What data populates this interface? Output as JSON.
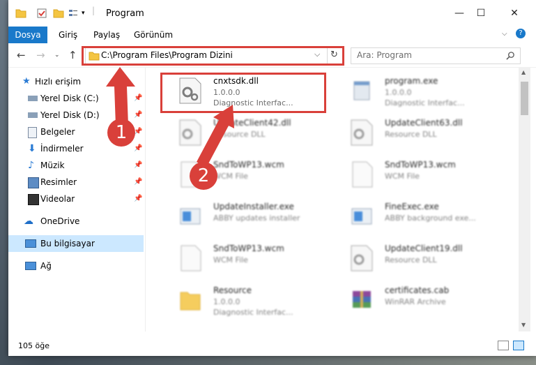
{
  "window": {
    "title": "Program"
  },
  "ribbon": {
    "file_tab": "Dosya",
    "tabs": [
      "Giriş",
      "Paylaş",
      "Görünüm"
    ]
  },
  "nav": {
    "address": "C:\\Program Files\\Program Dizini",
    "search_placeholder": "Ara: Program"
  },
  "sidebar": {
    "quick_access": "Hızlı erişim",
    "items": [
      {
        "label": "Yerel Disk (C:)",
        "icon": "drive-icon",
        "pinned": true
      },
      {
        "label": "Yerel Disk (D:)",
        "icon": "drive-icon",
        "pinned": true
      },
      {
        "label": "Belgeler",
        "icon": "documents-icon",
        "pinned": true
      },
      {
        "label": "İndirmeler",
        "icon": "download-icon",
        "pinned": true
      },
      {
        "label": "Müzik",
        "icon": "music-icon",
        "pinned": true
      },
      {
        "label": "Resimler",
        "icon": "pictures-icon",
        "pinned": true
      },
      {
        "label": "Videolar",
        "icon": "video-icon",
        "pinned": true
      }
    ],
    "onedrive": "OneDrive",
    "this_pc": "Bu bilgisayar",
    "network": "Ağ"
  },
  "files": [
    {
      "name": "cnxtsdk.dll",
      "line2": "1.0.0.0",
      "line3": "Diagnostic Interfac..."
    },
    {
      "name": "program.exe",
      "line2": "1.0.0.0",
      "line3": "Diagnostic Interfac..."
    },
    {
      "name": "UpdateClient42.dll",
      "line2": "Resource DLL",
      "line3": ""
    },
    {
      "name": "UpdateClient63.dll",
      "line2": "Resource DLL",
      "line3": ""
    },
    {
      "name": "SndToWP13.wcm",
      "line2": "WCM File",
      "line3": ""
    },
    {
      "name": "SndToWP13.wcm",
      "line2": "WCM File",
      "line3": ""
    },
    {
      "name": "UpdateInstaller.exe",
      "line2": "ABBY updates installer",
      "line3": ""
    },
    {
      "name": "FineExec.exe",
      "line2": "ABBY background exe...",
      "line3": ""
    },
    {
      "name": "SndToWP13.wcm",
      "line2": "WCM File",
      "line3": ""
    },
    {
      "name": "UpdateClient19.dll",
      "line2": "Resource DLL",
      "line3": ""
    },
    {
      "name": "Resource",
      "line2": "1.0.0.0",
      "line3": "Diagnostic Interfac..."
    },
    {
      "name": "certificates.cab",
      "line2": "WinRAR Archive",
      "line3": ""
    }
  ],
  "status": {
    "item_count": "105 öğe"
  },
  "annotations": {
    "step1": "1",
    "step2": "2",
    "color": "#d9403a"
  },
  "colors": {
    "accent": "#1979ca",
    "selection": "#cce8ff"
  }
}
